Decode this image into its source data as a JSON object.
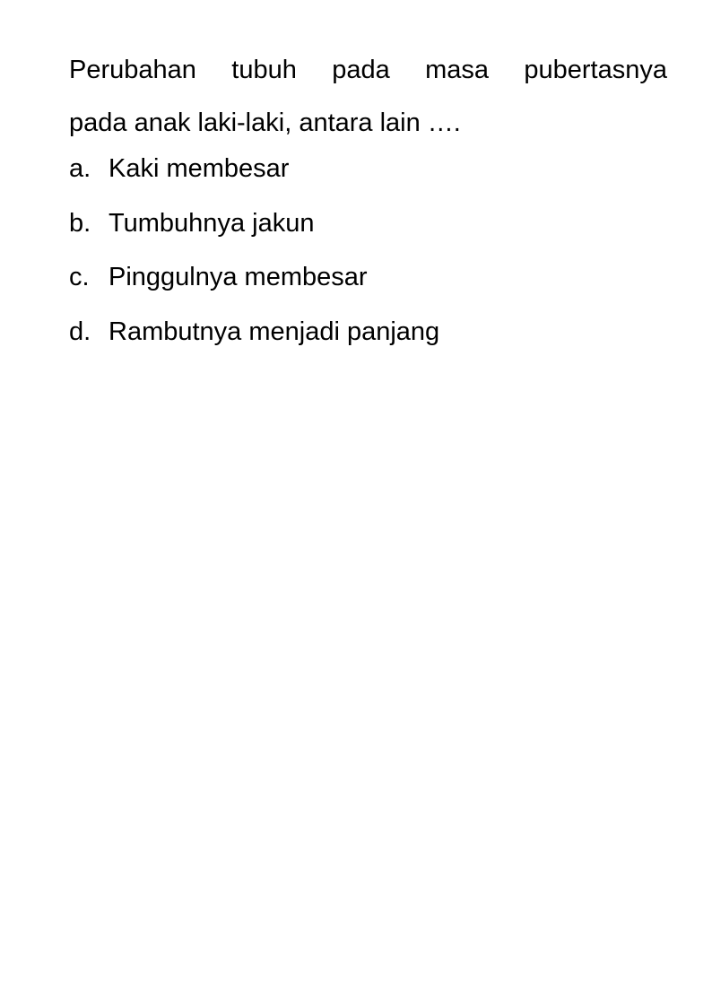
{
  "question": {
    "line1": "Perubahan tubuh pada masa pubertasnya",
    "line2": "pada anak laki-laki, antara lain …."
  },
  "options": [
    {
      "letter": "a.",
      "text": "Kaki membesar"
    },
    {
      "letter": "b.",
      "text": "Tumbuhnya jakun"
    },
    {
      "letter": "c.",
      "text": "Pinggulnya membesar"
    },
    {
      "letter": "d.",
      "text": "Rambutnya menjadi panjang"
    }
  ]
}
